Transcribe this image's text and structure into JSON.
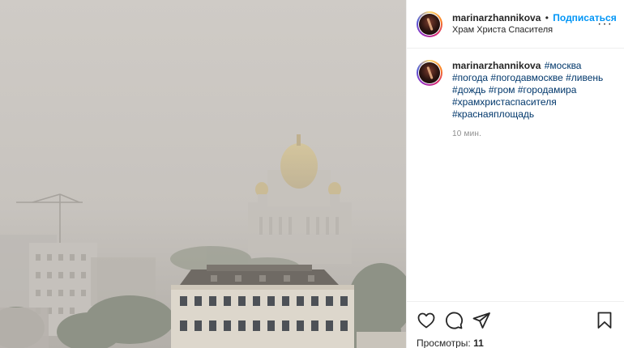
{
  "post": {
    "author": "marinarzhannikova",
    "separator": "•",
    "follow_label": "Подписаться",
    "location": "Храм Христа Спасителя",
    "more_icon": "more-options-icon",
    "more_label": "···",
    "caption": {
      "tags": [
        "#москва",
        "#погода",
        "#погодавмоскве",
        "#ливень",
        "#дождь",
        "#гром",
        "#городамира",
        "#храмхристаспасителя",
        "#краснаяплощадь"
      ]
    },
    "time": "10 мин.",
    "views_label": "Просмотры:",
    "views_count": "11"
  },
  "icons": {
    "like": "heart-icon",
    "comment": "comment-icon",
    "share": "paper-plane-icon",
    "save": "bookmark-icon"
  },
  "colors": {
    "link": "#0095f6",
    "hashtag": "#00376b",
    "muted": "#8e8e8e",
    "text": "#262626"
  }
}
